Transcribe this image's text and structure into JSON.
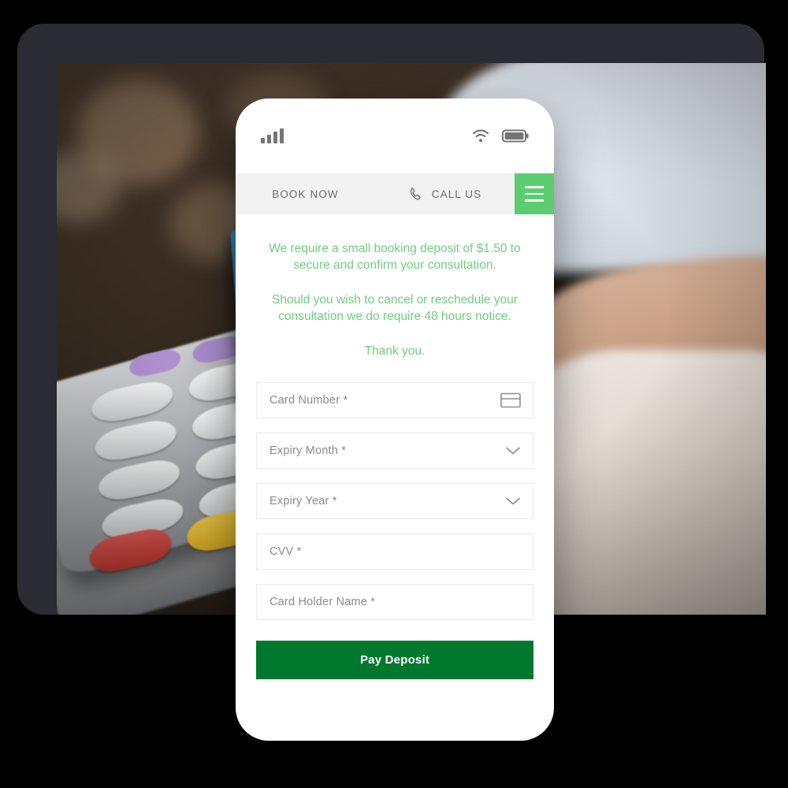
{
  "device": {
    "type": "tablet-with-phone-mockup",
    "frame_color": "#2b2b33",
    "background_color": "#000000"
  },
  "background_photo": {
    "description": "Blurred photo of a card payment terminal with a blue bank card being inserted, a barista in white shirt and dark apron, and a wooden counter"
  },
  "phone": {
    "status_bar": {
      "signal_icon": "signal-bars-icon",
      "signal_bars": 4,
      "wifi_icon": "wifi-icon",
      "battery_icon": "battery-icon"
    },
    "nav": {
      "items": [
        {
          "label": "BOOK NOW",
          "icon": null
        },
        {
          "label": "CALL US",
          "icon": "phone-icon"
        }
      ],
      "menu_icon": "hamburger-menu-icon",
      "menu_color": "#5ccd6f",
      "bar_color": "#f2f2f2"
    },
    "deposit_notice": {
      "color": "#6fce7c",
      "paragraphs": [
        "We require a small booking deposit of $1.50 to secure and confirm your consultation.",
        "Should you wish to cancel or reschedule your consultation we do require 48 hours notice.",
        "Thank you."
      ]
    },
    "payment_form": {
      "fields": [
        {
          "name": "card-number",
          "placeholder": "Card Number *",
          "value": "",
          "adornment": "credit-card-icon"
        },
        {
          "name": "expiry-month",
          "placeholder": "Expiry Month *",
          "value": "",
          "adornment": "chevron-down-icon"
        },
        {
          "name": "expiry-year",
          "placeholder": "Expiry Year *",
          "value": "",
          "adornment": "chevron-down-icon"
        },
        {
          "name": "cvv",
          "placeholder": "CVV *",
          "value": "",
          "adornment": null
        },
        {
          "name": "card-holder-name",
          "placeholder": "Card Holder Name *",
          "value": "",
          "adornment": null
        }
      ],
      "submit_label": "Pay Deposit",
      "submit_color": "#00792f"
    }
  }
}
